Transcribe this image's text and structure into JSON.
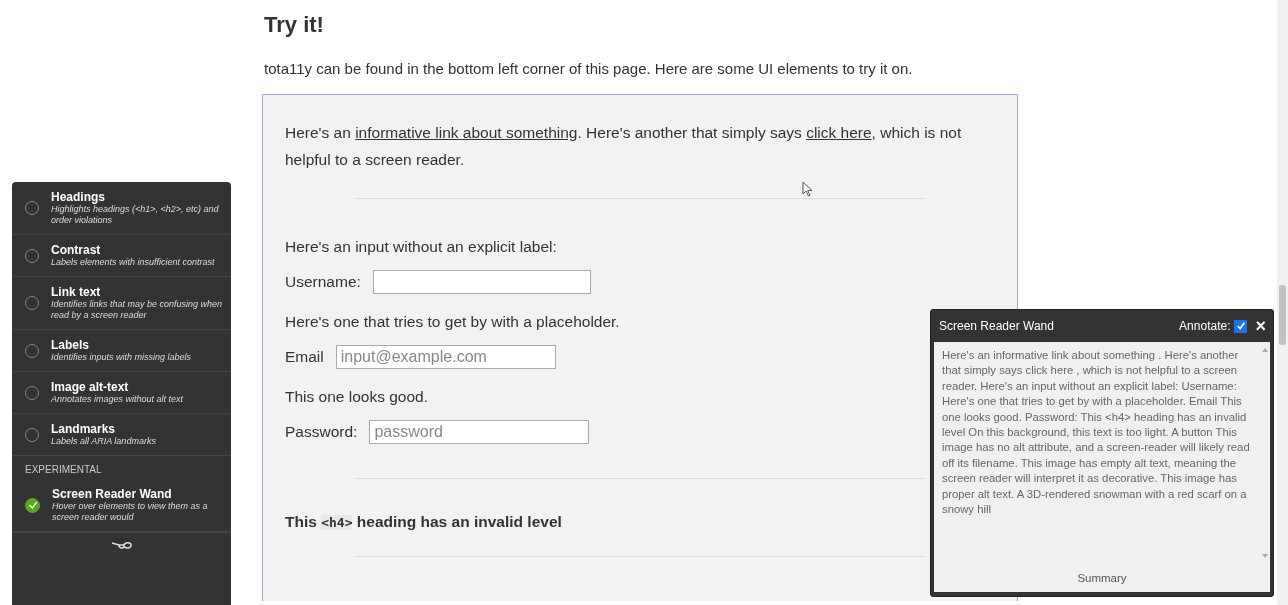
{
  "heading": "Try it!",
  "intro": "tota11y can be found in the bottom left corner of this page. Here are some UI elements to try it on.",
  "demo": {
    "link_paragraph": [
      {
        "kind": "text",
        "text": "Here's an "
      },
      {
        "kind": "link",
        "text": "informative link about something"
      },
      {
        "kind": "text",
        "text": ". Here's another that simply says "
      },
      {
        "kind": "link",
        "text": "click here"
      },
      {
        "kind": "text",
        "text": ", which is not helpful to a screen reader."
      }
    ],
    "unlabeled_intro": "Here's an input without an explicit label:",
    "username_label": "Username:",
    "placeholder_intro": "Here's one that tries to get by with a placeholder.",
    "email_label": "Email",
    "email_placeholder": "input@example.com",
    "good_intro": "This one looks good.",
    "password_label": "Password:",
    "password_placeholder": "password",
    "invalid_heading": {
      "before": "This ",
      "code": "<h4>",
      "after": " heading has an invalid level"
    }
  },
  "sidebar": {
    "plugins": [
      {
        "title": "Headings",
        "description": "Highlights headings (<h1>, <h2>, etc) and order violations",
        "selected": false
      },
      {
        "title": "Contrast",
        "description": "Labels elements with insufficient contrast",
        "selected": false
      },
      {
        "title": "Link text",
        "description": "Identifies links that may be confusing when read by a screen reader",
        "selected": false
      },
      {
        "title": "Labels",
        "description": "Identifies inputs with missing labels",
        "selected": false
      },
      {
        "title": "Image alt-text",
        "description": "Annotates images without alt text",
        "selected": false
      },
      {
        "title": "Landmarks",
        "description": "Labels all ARIA landmarks",
        "selected": false
      }
    ],
    "section_label": "EXPERIMENTAL",
    "experimental": [
      {
        "title": "Screen Reader Wand",
        "description": "Hover over elements to view them as a screen reader would",
        "selected": true
      }
    ]
  },
  "wand_panel": {
    "title": "Screen Reader Wand",
    "annotate_label": "Annotate:",
    "annotate_checked": true,
    "close": "×",
    "transcript": "Here's an informative link about something . Here's another that simply says click here , which is not helpful to a screen reader. Here's an input without an explicit label: Username: Here's one that tries to get by with a placeholder. Email This one looks good. Password: This <h4> heading has an invalid level On this background, this text is too light. A button This image has no alt attribute, and a screen-reader will likely read off its filename. This image has empty alt text, meaning the screen reader will interpret it as decorative. This image has proper alt text. A 3D-rendered snowman with a red scarf on a snowy hill",
    "summary_button": "Summary"
  }
}
